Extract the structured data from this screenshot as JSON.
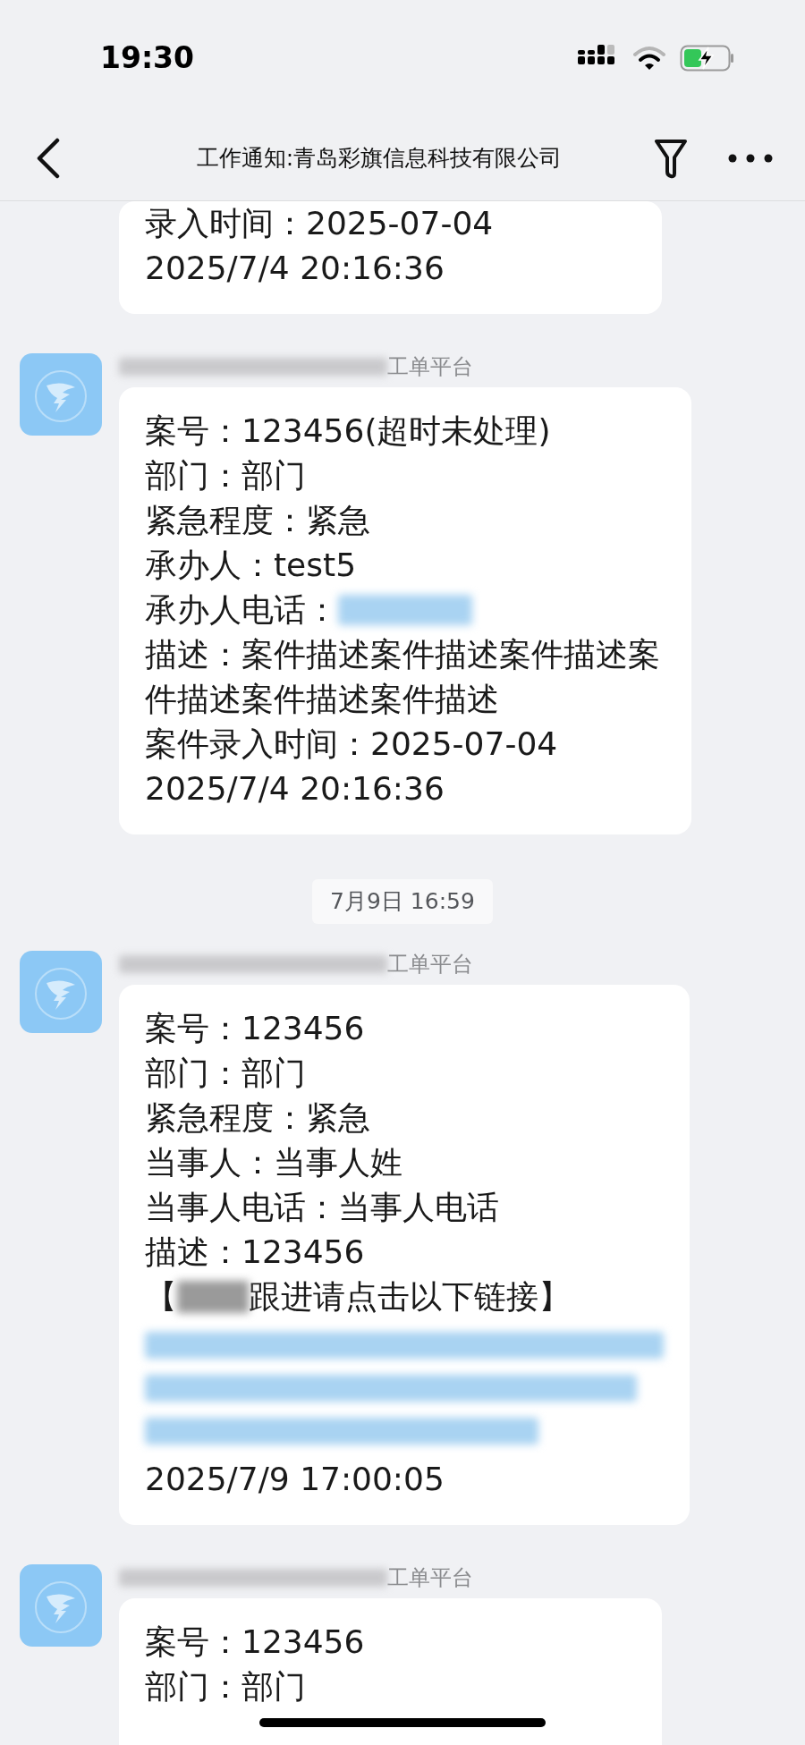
{
  "status_bar": {
    "time": "19:30",
    "charging": true
  },
  "nav": {
    "title": "工作通知:青岛彩旗信息科技有限公司"
  },
  "messages": [
    {
      "kind": "message",
      "lines": [
        {
          "kind": "text",
          "text": "录入时间：2025-07-04"
        },
        {
          "kind": "text",
          "text": "2025/7/4 20:16:36"
        }
      ]
    },
    {
      "kind": "message",
      "sender": "工单平台",
      "lines": [
        {
          "kind": "text",
          "text": "案号：123456(超时未处理)"
        },
        {
          "kind": "text",
          "text": "部门：部门"
        },
        {
          "kind": "text",
          "text": "紧急程度：紧急"
        },
        {
          "kind": "text",
          "text": "承办人：test5"
        },
        {
          "kind": "redacted_value",
          "text": "承办人电话："
        },
        {
          "kind": "text",
          "text": "描述：案件描述案件描述案件描述案件描述案件描述案件描述"
        },
        {
          "kind": "text",
          "text": "案件录入时间：2025-07-04"
        },
        {
          "kind": "text",
          "text": "2025/7/4 20:16:36"
        }
      ]
    },
    {
      "kind": "timestamp",
      "text": "7月9日 16:59"
    },
    {
      "kind": "message",
      "sender": "工单平台",
      "lines": [
        {
          "kind": "text",
          "text": "案号：123456"
        },
        {
          "kind": "text",
          "text": "部门：部门"
        },
        {
          "kind": "text",
          "text": "紧急程度：紧急"
        },
        {
          "kind": "text",
          "text": "当事人：当事人姓"
        },
        {
          "kind": "text",
          "text": "当事人电话：当事人电话"
        },
        {
          "kind": "text",
          "text": "描述：123456"
        },
        {
          "kind": "redacted_inline",
          "prefix": "【",
          "text": "跟进请点击以下链接】"
        },
        {
          "kind": "redacted_link"
        },
        {
          "kind": "text",
          "text": "2025/7/9 17:00:05"
        }
      ]
    },
    {
      "kind": "message",
      "sender": "工单平台",
      "lines": [
        {
          "kind": "text",
          "text": "案号：123456"
        },
        {
          "kind": "text",
          "text": "部门：部门"
        }
      ]
    }
  ]
}
